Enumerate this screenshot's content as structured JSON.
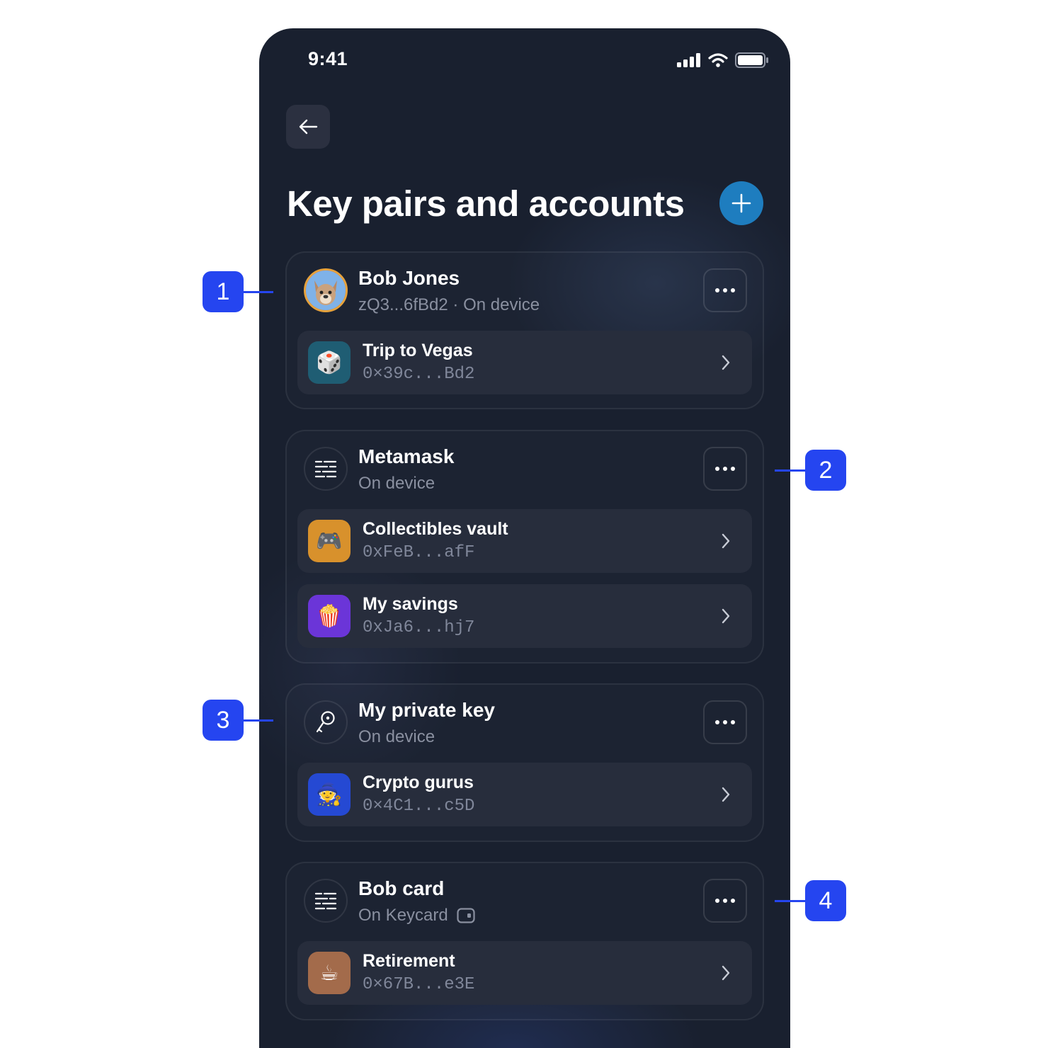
{
  "status_bar": {
    "time": "9:41"
  },
  "page": {
    "title": "Key pairs and accounts"
  },
  "keypairs": [
    {
      "name": "Bob Jones",
      "subtitle": "zQ3...6fBd2 · On device",
      "icon": "avatar-image",
      "accounts": [
        {
          "name": "Trip to Vegas",
          "address": "0×39c...Bd2",
          "emoji": "🎲",
          "color": "#1f5d73"
        }
      ]
    },
    {
      "name": "Metamask",
      "subtitle": "On device",
      "icon": "seed-phrase-icon",
      "accounts": [
        {
          "name": "Collectibles vault",
          "address": "0xFeB...afF",
          "emoji": "🎮",
          "color": "#d8912c"
        },
        {
          "name": "My savings",
          "address": "0xJa6...hj7",
          "emoji": "🍿",
          "color": "#6b35d8"
        }
      ]
    },
    {
      "name": "My private key",
      "subtitle": "On device",
      "icon": "key-icon",
      "accounts": [
        {
          "name": "Crypto gurus",
          "address": "0×4C1...c5D",
          "emoji": "🧙",
          "color": "#2549d3"
        }
      ]
    },
    {
      "name": "Bob card",
      "subtitle": "On Keycard",
      "icon": "seed-phrase-icon",
      "accounts": [
        {
          "name": "Retirement",
          "address": "0×67B...e3E",
          "emoji": "☕",
          "color": "#a36b4b"
        }
      ]
    }
  ],
  "annotations": [
    "1",
    "2",
    "3",
    "4"
  ],
  "colors": {
    "background": "#19202f",
    "accent": "#1e7dbf",
    "marker": "#2545f0"
  }
}
